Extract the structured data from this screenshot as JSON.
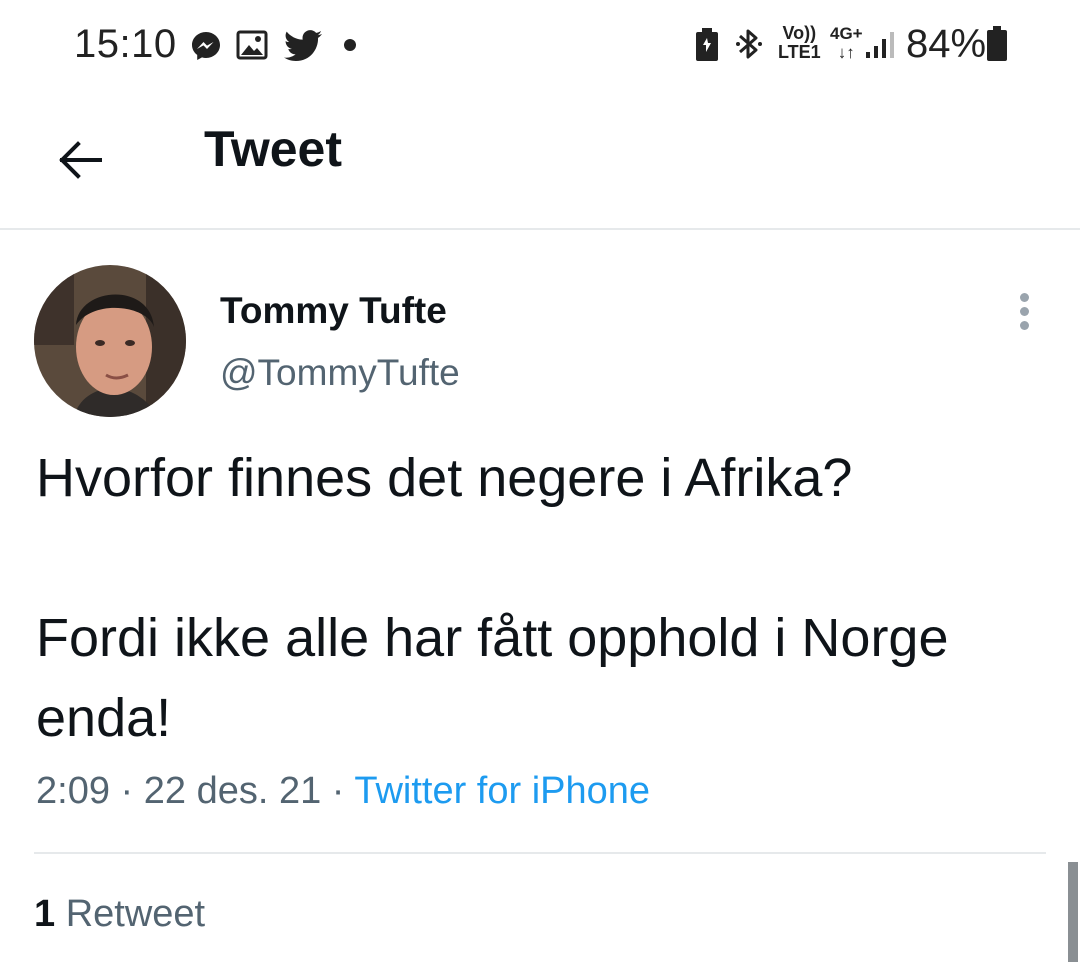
{
  "status_bar": {
    "time": "15:10",
    "volte_top": "Vo))",
    "volte_bottom": "LTE1",
    "network_type": "4G+",
    "network_arrows": "↓↑",
    "battery_percent": "84%",
    "icons": [
      "messenger-icon",
      "gallery-icon",
      "twitter-icon",
      "notification-dot",
      "battery-saver-icon",
      "bluetooth-icon",
      "signal-icon",
      "battery-icon"
    ]
  },
  "header": {
    "back_icon": "arrow-left-icon",
    "title": "Tweet"
  },
  "tweet": {
    "display_name": "Tommy Tufte",
    "handle": "@TommyTufte",
    "paragraphs": [
      "Hvorfor finnes det negere i Afrika?",
      "Fordi ikke alle har fått opphold i Norge enda!"
    ],
    "time": "2:09",
    "separator": "·",
    "date": "22 des. 21",
    "source": "Twitter for iPhone",
    "retweet_count": "1",
    "retweet_label": "Retweet"
  },
  "colors": {
    "text_primary": "#0f1419",
    "text_secondary": "#536471",
    "link": "#1d9bf0",
    "divider": "#e6e9eb"
  }
}
